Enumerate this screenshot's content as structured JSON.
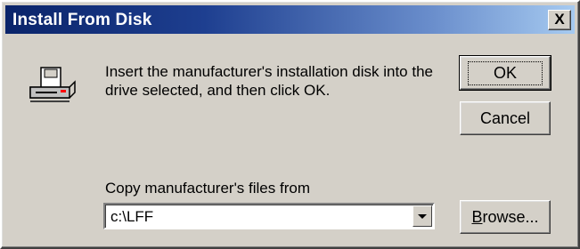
{
  "window": {
    "title": "Install From Disk",
    "close_label": "X"
  },
  "message": "Insert the manufacturer's installation disk into the drive selected, and then click OK.",
  "buttons": {
    "ok": "OK",
    "cancel": "Cancel",
    "browse_accel": "B",
    "browse_rest": "rowse..."
  },
  "copy_from": {
    "label": "Copy manufacturer's files from",
    "value": "c:\\LFF"
  },
  "icons": {
    "dialog_icon": "floppy-drive-icon",
    "dropdown": "chevron-down-icon"
  },
  "colors": {
    "title_bar_start": "#0a246a",
    "title_bar_end": "#a6caf0",
    "dialog_face": "#d4d0c8"
  }
}
